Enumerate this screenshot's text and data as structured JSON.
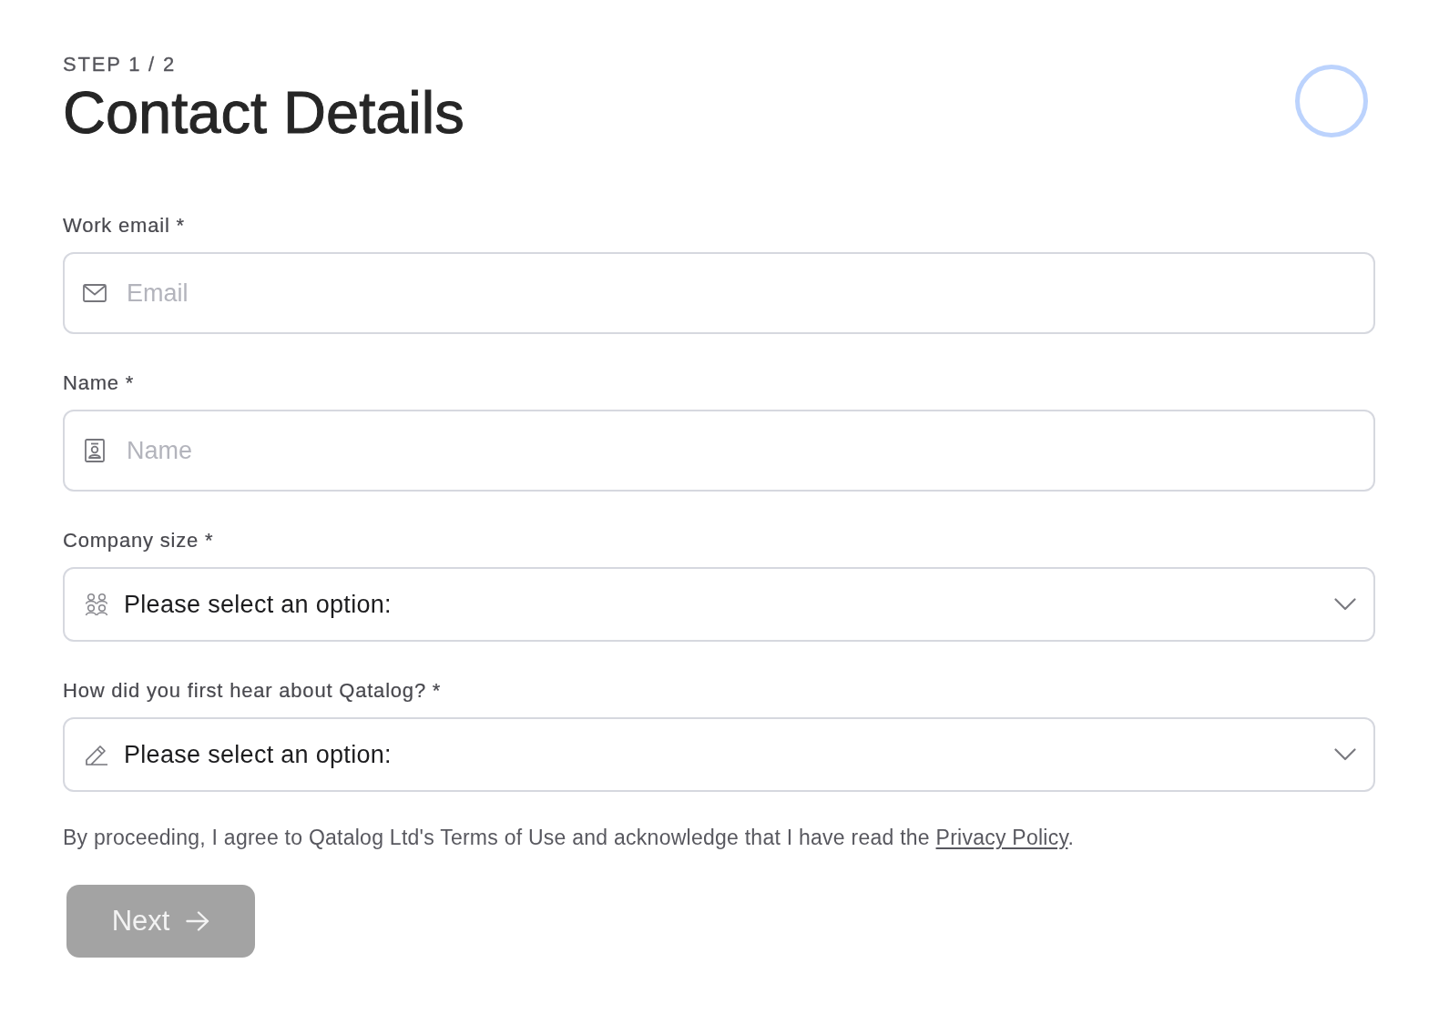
{
  "header": {
    "step": "STEP 1 / 2",
    "title": "Contact Details"
  },
  "fields": [
    {
      "kind": "input",
      "label": "Work email *",
      "placeholder": "Email"
    },
    {
      "kind": "input",
      "label": "Name *",
      "placeholder": "Name"
    },
    {
      "kind": "select",
      "label": "Company size *",
      "value": "Please select an option:"
    },
    {
      "kind": "select",
      "label": "How did you first hear about Qatalog? *",
      "value": "Please select an option:"
    }
  ],
  "consent": {
    "text_before": "By proceeding, I agree to Qatalog Ltd's Terms of Use and acknowledge that I have read the ",
    "link": "Privacy Policy",
    "text_after": "."
  },
  "next_button": {
    "label": "Next",
    "disabled": true
  }
}
